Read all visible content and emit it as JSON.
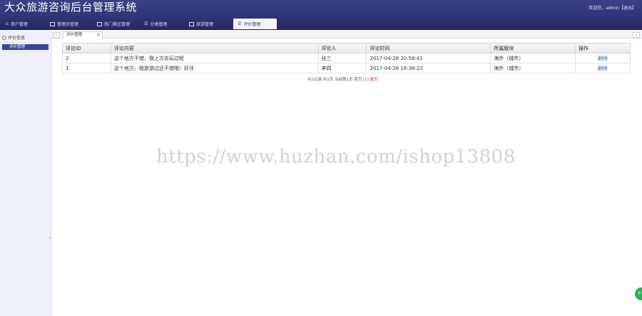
{
  "app": {
    "title": "大众旅游咨询后台管理系统",
    "welcome": "欢迎您，admin【退出】"
  },
  "nav": {
    "tabs": [
      {
        "label": "用户管理",
        "icon": "home-icon"
      },
      {
        "label": "管理员管理",
        "icon": "window-icon"
      },
      {
        "label": "热门景区管理",
        "icon": "window-icon"
      },
      {
        "label": "分类管理",
        "icon": "list-icon"
      },
      {
        "label": "旅游管理",
        "icon": "window-icon"
      },
      {
        "label": "评价管理",
        "icon": "list-icon",
        "active": true
      }
    ]
  },
  "sidebar": {
    "group_label": "评价信息",
    "items": [
      {
        "label": "评价管理",
        "active": true
      }
    ]
  },
  "content_tabs": [
    {
      "label": "评价管理"
    }
  ],
  "table": {
    "columns": [
      "评论ID",
      "评论内容",
      "评论人",
      "评论时间",
      "所属版块",
      "操作"
    ],
    "rows": [
      {
        "id": "2",
        "content": "这个地方不错，我上次去玩过呢",
        "user": "张三",
        "time": "2017-04-28 20:58:41",
        "section": "海外（城市）",
        "action": "删除"
      },
      {
        "id": "1",
        "content": "这个地方，我旅游过还不错哦！好评",
        "user": "李四",
        "time": "2017-04-28 18:38:22",
        "section": "海外（城市）",
        "action": "删除"
      }
    ]
  },
  "pager": {
    "summary": "共2记录 共1页 当前第1页",
    "first": "首页",
    "current": "[1]",
    "last": "尾页"
  },
  "watermark": "https://www.huzhan.com/ishop13808",
  "colors": {
    "header": "#2f3474",
    "accent": "#3a4597",
    "link": "#2b66b1"
  }
}
